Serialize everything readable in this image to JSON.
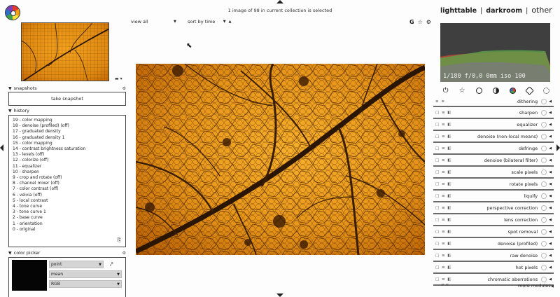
{
  "header": {
    "collection_info": "1 image of 98 in current collection is selected",
    "filter": {
      "view_label": "view",
      "view_value": "all",
      "sort_label": "sort by",
      "sort_value": "time",
      "sort_dir_icon": "ascending-arrow-icon"
    },
    "tool_icons": [
      "grouping-G-icon",
      "star-overlay-icon",
      "preferences-gear-icon"
    ]
  },
  "view_switcher": {
    "items": [
      "lighttable",
      "darkroom",
      "other"
    ],
    "active": "darkroom",
    "separator": "|"
  },
  "histogram": {
    "info": "1/180 f/0,0 0mm iso 100"
  },
  "left_panel": {
    "snapshots": {
      "title": "snapshots",
      "button": "take snapshot"
    },
    "history": {
      "title": "history",
      "items": [
        "19 - color mapping",
        "18 - denoise (profiled)   (off)",
        "17 - graduated density",
        "16 - graduated density 1",
        "15 - color mapping",
        "14 - contrast brightness saturation",
        "13 - levels   (off)",
        "12 - colorize   (off)",
        "11 - equalizer",
        "10 - sharpen",
        "9 - crop and rotate   (off)",
        "8 - channel mixer   (off)",
        "7 - color contrast   (off)",
        "6 - velvia   (off)",
        "5 - local contrast",
        "4 - tone curve",
        "3 - tone curve 1",
        "2 - base curve",
        "1 - orientation",
        "0 - original"
      ]
    },
    "color_picker": {
      "title": "color picker",
      "mode": "point",
      "statistic": "mean",
      "color_space": "RGB",
      "swatch_color": "#050505"
    }
  },
  "modules": [
    {
      "name": "dithering",
      "icon": "dithering-icon",
      "partial": true
    },
    {
      "name": "sharpen",
      "icon": "sharpen-icon"
    },
    {
      "name": "equalizer",
      "icon": "equalizer-icon"
    },
    {
      "name": "denoise (non-local means)",
      "icon": "denoise-nlm-icon"
    },
    {
      "name": "defringe",
      "icon": "defringe-icon"
    },
    {
      "name": "denoise (bilateral filter)",
      "icon": "denoise-bilateral-icon"
    },
    {
      "name": "scale pixels",
      "icon": "scale-pixels-icon"
    },
    {
      "name": "rotate pixels",
      "icon": "rotate-pixels-icon"
    },
    {
      "name": "liquify",
      "icon": "liquify-icon"
    },
    {
      "name": "perspective correction",
      "icon": "perspective-icon"
    },
    {
      "name": "lens correction",
      "icon": "lens-icon"
    },
    {
      "name": "spot removal",
      "icon": "spot-removal-icon"
    },
    {
      "name": "denoise (profiled)",
      "icon": "denoise-profiled-icon"
    },
    {
      "name": "raw denoise",
      "icon": "raw-denoise-icon"
    },
    {
      "name": "hot pixels",
      "icon": "hot-pixels-icon"
    },
    {
      "name": "chromatic aberrations",
      "icon": "chromatic-aberrations-icon"
    }
  ],
  "more_modules": "more modules",
  "colors": {
    "leaf_orange": "#e8961a",
    "leaf_dark": "#3a1e02",
    "histogram_bg": "#3f3f3f"
  }
}
